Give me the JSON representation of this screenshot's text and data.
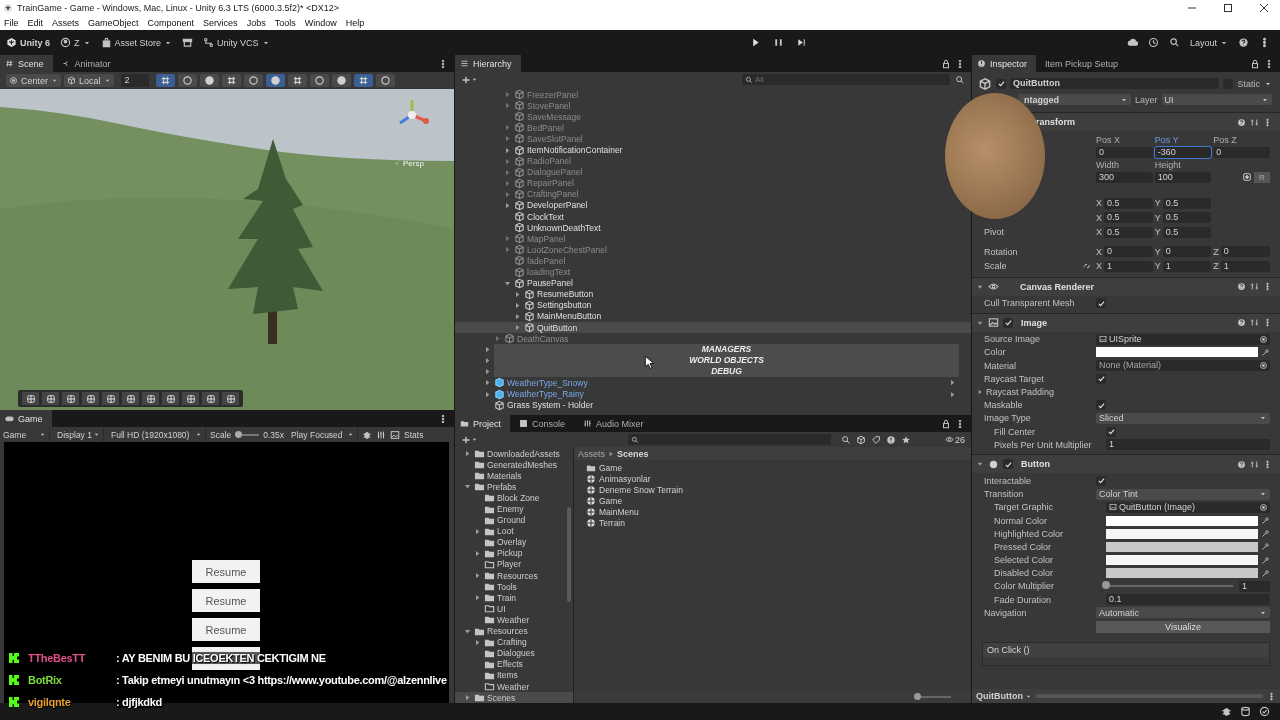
{
  "window": {
    "title": "TrainGame - Game - Windows, Mac, Linux - Unity 6.3 LTS (6000.3.5f2)* <DX12>"
  },
  "menu": [
    "File",
    "Edit",
    "Assets",
    "GameObject",
    "Component",
    "Services",
    "Jobs",
    "Tools",
    "Window",
    "Help"
  ],
  "toolbar": {
    "product": "Unity 6",
    "account": "Z",
    "store": "Asset Store",
    "vcs": "Unity VCS",
    "layout": "Layout"
  },
  "scene": {
    "tabs": [
      {
        "label": "Scene",
        "selected": true
      },
      {
        "label": "Animator",
        "selected": false
      }
    ],
    "pivot": "Center",
    "space": "Local",
    "grid_size": "2",
    "projection": "Persp"
  },
  "game": {
    "tab": "Game",
    "view": "Game",
    "display": "Display 1",
    "resolution": "Full HD (1920x1080)",
    "scale_label": "Scale",
    "scale": {
      "level": 0.1
    },
    "scale_value": "0.35x",
    "play_mode": "Play Focused",
    "stats": "Stats",
    "buttons": [
      {
        "kind": "labeled",
        "label": "Resume"
      },
      {
        "kind": "labeled",
        "label": "Resume"
      },
      {
        "kind": "labeled",
        "label": "Resume"
      },
      {
        "kind": "blank"
      }
    ]
  },
  "hierarchy": {
    "title": "Hierarchy",
    "search_placeholder": "All",
    "tree": [
      {
        "children": [
          {
            "children": [
              {
                "name": "FreezerPanel",
                "kind": "object",
                "active": false,
                "expandable": true,
                "expanded": false,
                "selected": false
              },
              {
                "name": "StovePanel",
                "kind": "object",
                "active": false,
                "expandable": true,
                "expanded": false,
                "selected": false
              },
              {
                "name": "SaveMessage",
                "kind": "object",
                "active": false,
                "expandable": false,
                "selected": false
              },
              {
                "name": "BedPanel",
                "kind": "object",
                "active": false,
                "expandable": true,
                "expanded": false,
                "selected": false
              },
              {
                "name": "SaveSlotPanel",
                "kind": "object",
                "active": false,
                "expandable": true,
                "expanded": false,
                "selected": false
              },
              {
                "name": "ItemNotificationContainer",
                "kind": "object",
                "active": true,
                "expandable": true,
                "expanded": false,
                "selected": false
              },
              {
                "name": "RadioPanel",
                "kind": "object",
                "active": false,
                "expandable": true,
                "expanded": false,
                "selected": false
              },
              {
                "name": "DialoguePanel",
                "kind": "object",
                "active": false,
                "expandable": true,
                "expanded": false,
                "selected": false
              },
              {
                "name": "RepairPanel",
                "kind": "object",
                "active": false,
                "expandable": true,
                "expanded": false,
                "selected": false
              },
              {
                "name": "CraftingPanel",
                "kind": "object",
                "active": false,
                "expandable": true,
                "expanded": false,
                "selected": false
              },
              {
                "name": "DeveloperPanel",
                "kind": "object",
                "active": true,
                "expandable": true,
                "expanded": false,
                "selected": false
              },
              {
                "name": "ClockText",
                "kind": "object",
                "active": true,
                "expandable": false,
                "selected": false
              },
              {
                "name": "UnknownDeathText",
                "kind": "object",
                "active": true,
                "expandable": false,
                "selected": false
              },
              {
                "name": "MapPanel",
                "kind": "object",
                "active": false,
                "expandable": true,
                "expanded": false,
                "selected": false
              },
              {
                "name": "LootZoneChestPanel",
                "kind": "object",
                "active": false,
                "expandable": true,
                "expanded": false,
                "selected": false
              },
              {
                "name": "fadePanel",
                "kind": "object",
                "active": false,
                "expandable": false,
                "selected": false
              },
              {
                "name": "loadingText",
                "kind": "object",
                "active": false,
                "expandable": false,
                "selected": false
              },
              {
                "name": "PausePanel",
                "kind": "object",
                "active": true,
                "expandable": true,
                "expanded": true,
                "selected": false,
                "children": [
                  {
                    "name": "ResumeButton",
                    "kind": "object",
                    "active": true,
                    "expandable": true,
                    "expanded": false,
                    "selected": false
                  },
                  {
                    "name": "Settingsbutton",
                    "kind": "object",
                    "active": true,
                    "expandable": true,
                    "expanded": false,
                    "selected": false
                  },
                  {
                    "name": "MainMenuButton",
                    "kind": "object",
                    "active": true,
                    "expandable": true,
                    "expanded": false,
                    "selected": false
                  },
                  {
                    "name": "QuitButton",
                    "kind": "object",
                    "active": true,
                    "expandable": true,
                    "expanded": false,
                    "selected": true
                  }
                ]
              }
            ]
          },
          {
            "name": "DeathCanvas",
            "kind": "object",
            "active": false,
            "expandable": true,
            "expanded": false,
            "selected": false
          }
        ]
      },
      {
        "name": "MANAGERS",
        "kind": "header",
        "expanded": false
      },
      {
        "name": "WORLD OBJECTS",
        "kind": "header",
        "expanded": false
      },
      {
        "name": "DEBUG",
        "kind": "header",
        "expanded": false
      },
      {
        "name": "WeatherType_Snowy",
        "kind": "prefab",
        "active": true,
        "expandable": true,
        "expanded": false,
        "selected": false
      },
      {
        "name": "WeatherType_Rainy",
        "kind": "prefab",
        "active": true,
        "expandable": true,
        "expanded": false,
        "selected": false
      },
      {
        "name": "Grass System - Holder",
        "kind": "object",
        "active": true,
        "expandable": false,
        "selected": false
      }
    ]
  },
  "project": {
    "tabs": [
      {
        "label": "Project",
        "selected": true
      },
      {
        "label": "Console",
        "selected": false
      },
      {
        "label": "Audio Mixer",
        "selected": false
      }
    ],
    "hidden_count": "26",
    "tree": [
      {
        "name": "DownloadedAssets",
        "expandable": true,
        "expanded": false,
        "empty": false,
        "selected": false
      },
      {
        "name": "GeneratedMeshes",
        "expandable": false,
        "empty": false,
        "selected": false
      },
      {
        "name": "Materials",
        "expandable": false,
        "empty": false,
        "selected": false
      },
      {
        "name": "Prefabs",
        "expandable": true,
        "expanded": true,
        "empty": false,
        "selected": false,
        "children": [
          {
            "name": "Block Zone",
            "expandable": false,
            "empty": false,
            "selected": false
          },
          {
            "name": "Enemy",
            "expandable": false,
            "empty": false,
            "selected": false
          },
          {
            "name": "Ground",
            "expandable": false,
            "empty": false,
            "selected": false
          },
          {
            "name": "Loot",
            "expandable": true,
            "expanded": false,
            "empty": false,
            "selected": false
          },
          {
            "name": "Overlay",
            "expandable": false,
            "empty": false,
            "selected": false
          },
          {
            "name": "Pickup",
            "expandable": true,
            "expanded": false,
            "empty": false,
            "selected": false
          },
          {
            "name": "Player",
            "expandable": false,
            "empty": true,
            "selected": false
          },
          {
            "name": "Resources",
            "expandable": true,
            "expanded": false,
            "empty": false,
            "selected": false
          },
          {
            "name": "Tools",
            "expandable": false,
            "empty": false,
            "selected": false
          },
          {
            "name": "Train",
            "expandable": true,
            "expanded": false,
            "empty": false,
            "selected": false
          },
          {
            "name": "UI",
            "expandable": false,
            "empty": true,
            "selected": false
          },
          {
            "name": "Weather",
            "expandable": false,
            "empty": false,
            "selected": false
          }
        ]
      },
      {
        "name": "Resources",
        "expandable": true,
        "expanded": true,
        "empty": false,
        "selected": false,
        "children": [
          {
            "name": "Crafting",
            "expandable": true,
            "expanded": false,
            "empty": false,
            "selected": false
          },
          {
            "name": "Dialogues",
            "expandable": false,
            "empty": false,
            "selected": false
          },
          {
            "name": "Effects",
            "expandable": false,
            "empty": false,
            "selected": false
          },
          {
            "name": "Items",
            "expandable": false,
            "empty": false,
            "selected": false
          },
          {
            "name": "Weather",
            "expandable": false,
            "empty": true,
            "selected": false
          }
        ]
      },
      {
        "name": "Scenes",
        "expandable": true,
        "expanded": false,
        "empty": false,
        "selected": true
      }
    ],
    "path": [
      "Assets",
      "Scenes"
    ],
    "assets": [
      {
        "kind": "folder",
        "name": "Game"
      },
      {
        "kind": "scene",
        "name": "Animasyonlar"
      },
      {
        "kind": "scene",
        "name": "Deneme Snow Terrain"
      },
      {
        "kind": "scene",
        "name": "Game"
      },
      {
        "kind": "scene",
        "name": "MainMenu"
      },
      {
        "kind": "scene",
        "name": "Terrain"
      }
    ],
    "zoom": {
      "level": 0
    }
  },
  "inspector": {
    "tabs": [
      {
        "label": "Inspector",
        "selected": true
      },
      {
        "label": "Item Pickup Setup",
        "selected": false
      }
    ],
    "object": {
      "name": "QuitButton",
      "active": true,
      "static_label": "Static",
      "static": false,
      "tag": "ntagged",
      "layer_label": "Layer",
      "layer": "UI"
    },
    "components": [
      {
        "kind": "rect",
        "title": "ransform",
        "rows": [
          {
            "kind": "labels",
            "cells": [
              {
                "text": "Pos X",
                "focused": false
              },
              {
                "text": "Pos Y",
                "focused": true
              },
              {
                "text": "Pos Z",
                "focused": false
              }
            ]
          },
          {
            "kind": "values",
            "cells": [
              {
                "value": "0",
                "focused": false
              },
              {
                "value": "-360",
                "focused": true
              },
              {
                "value": "0",
                "focused": false
              }
            ]
          },
          {
            "kind": "labels",
            "cells": [
              {
                "text": "Width",
                "focused": false
              },
              {
                "text": "Height",
                "focused": false
              }
            ]
          },
          {
            "kind": "values",
            "cells": [
              {
                "value": "300",
                "focused": false
              },
              {
                "value": "100",
                "focused": false
              }
            ],
            "button": "R"
          },
          {
            "kind": "vector",
            "parts": [
              {
                "axis": "X",
                "value": "0.5"
              },
              {
                "axis": "Y",
                "value": "0.5"
              }
            ]
          },
          {
            "kind": "vector",
            "parts": [
              {
                "axis": "X",
                "value": "0.5"
              },
              {
                "axis": "Y",
                "value": "0.5"
              }
            ]
          },
          {
            "kind": "vector",
            "label": "Pivot",
            "parts": [
              {
                "axis": "X",
                "value": "0.5"
              },
              {
                "axis": "Y",
                "value": "0.5"
              }
            ]
          },
          {
            "kind": "vector",
            "label": "Rotation",
            "parts": [
              {
                "axis": "X",
                "value": "0"
              },
              {
                "axis": "Y",
                "value": "0"
              },
              {
                "axis": "Z",
                "value": "0"
              }
            ]
          },
          {
            "kind": "vector",
            "label": "Scale",
            "link": true,
            "parts": [
              {
                "axis": "X",
                "value": "1"
              },
              {
                "axis": "Y",
                "value": "1"
              },
              {
                "axis": "Z",
                "value": "1"
              }
            ]
          }
        ]
      },
      {
        "kind": "canvas",
        "title": "Canvas Renderer",
        "rows": [
          {
            "kind": "check",
            "label": "Cull Transparent Mesh",
            "checked": true
          }
        ]
      },
      {
        "kind": "image",
        "title": "Image",
        "enabled": true,
        "rows": [
          {
            "kind": "object",
            "label": "Source Image",
            "value": "UISprite",
            "empty": false
          },
          {
            "kind": "color",
            "label": "Color",
            "color": "#ffffff"
          },
          {
            "kind": "object",
            "label": "Material",
            "value": "None (Material)",
            "empty": true
          },
          {
            "kind": "check",
            "label": "Raycast Target",
            "checked": true
          },
          {
            "kind": "foldout",
            "label": "Raycast Padding"
          },
          {
            "kind": "check",
            "label": "Maskable",
            "checked": true
          },
          {
            "kind": "dropdown",
            "label": "Image Type",
            "value": "Sliced",
            "children": [
              {
                "kind": "check",
                "label": "Fill Center",
                "checked": true
              },
              {
                "kind": "text",
                "label": "Pixels Per Unit Multiplier",
                "value": "1"
              }
            ]
          }
        ]
      },
      {
        "kind": "button",
        "title": "Button",
        "enabled": true,
        "rows": [
          {
            "kind": "check",
            "label": "Interactable",
            "checked": true
          },
          {
            "kind": "dropdown",
            "label": "Transition",
            "value": "Color Tint",
            "children": [
              {
                "kind": "object",
                "label": "Target Graphic",
                "value": "QuitButton (Image)",
                "empty": false
              },
              {
                "kind": "color",
                "label": "Normal Color",
                "color": "#ffffff"
              },
              {
                "kind": "color",
                "label": "Highlighted Color",
                "color": "#f5f5f5"
              },
              {
                "kind": "color",
                "label": "Pressed Color",
                "color": "#c8c8c8"
              },
              {
                "kind": "color",
                "label": "Selected Color",
                "color": "#f5f5f5"
              },
              {
                "kind": "color",
                "label": "Disabled Color",
                "color": "#c8c8c8"
              },
              {
                "kind": "slider",
                "label": "Color Multiplier",
                "level": 0,
                "reading": "1"
              },
              {
                "kind": "text",
                "label": "Fade Duration",
                "value": "0.1"
              }
            ]
          },
          {
            "kind": "dropdown",
            "label": "Navigation",
            "value": "Automatic"
          },
          {
            "kind": "action",
            "label": "Visualize"
          }
        ]
      }
    ],
    "event": "On Click ()",
    "preview": "QuitButton"
  },
  "chat": [
    {
      "user": "TTheBesTT",
      "color": "#e0508a",
      "text": ": AY BENIM BU ICEOEKTEN CEKTIGIM NE"
    },
    {
      "user": "BotRix",
      "color": "#7ddc3a",
      "text": ": Takip etmeyi unutmayın <3 https://www.youtube.com/@alzennlive"
    },
    {
      "user": "vigilqnte",
      "color": "#e8a030",
      "text": ": djfjkdkd"
    }
  ]
}
